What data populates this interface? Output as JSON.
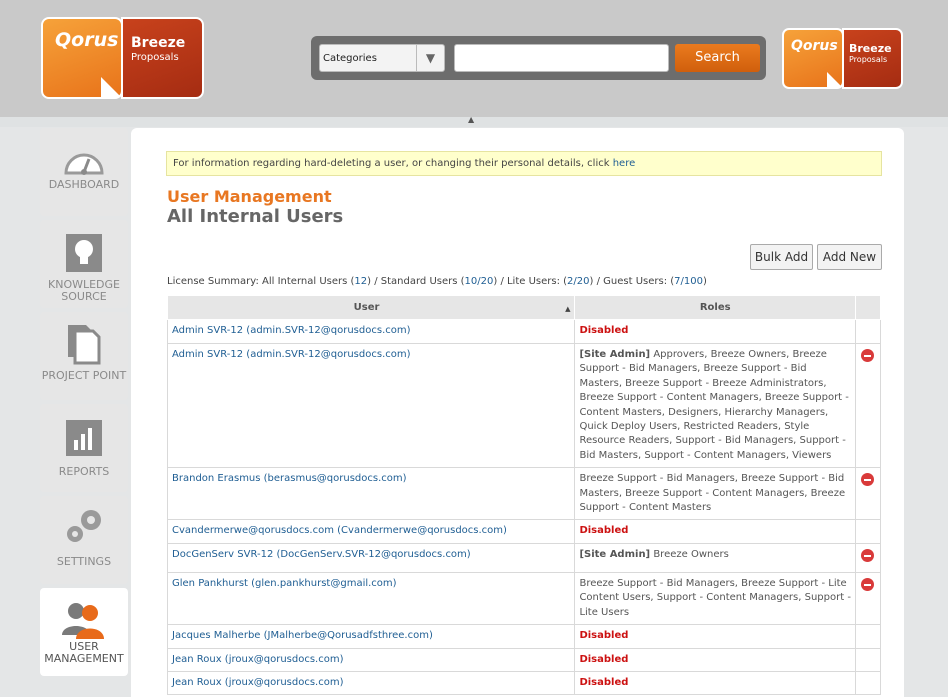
{
  "header": {
    "logo": {
      "brand": "Qorus",
      "product": "Breeze",
      "sub": "Proposals"
    },
    "search": {
      "category": "Categories",
      "placeholder": "",
      "button": "Search"
    }
  },
  "sidebar": {
    "items": [
      {
        "label": "DASHBOARD",
        "icon": "dashboard-gauge-icon"
      },
      {
        "label": "KNOWLEDGE SOURCE",
        "icon": "lightbulb-icon"
      },
      {
        "label": "PROJECT POINT",
        "icon": "documents-icon"
      },
      {
        "label": "REPORTS",
        "icon": "bar-chart-icon"
      },
      {
        "label": "SETTINGS",
        "icon": "gears-icon"
      },
      {
        "label": "USER MANAGEMENT",
        "icon": "users-icon",
        "active": true
      }
    ]
  },
  "main": {
    "info": {
      "text": "For information regarding hard-deleting a user, or changing their personal details, click ",
      "link": "here"
    },
    "title": "User Management",
    "subtitle": "All Internal Users",
    "buttons": {
      "bulk_add": "Bulk Add",
      "add_new": "Add New"
    },
    "license": {
      "prefix": "License Summary: All Internal Users (",
      "all": "12",
      "standard_label": ") / Standard Users (",
      "standard": "10/20",
      "lite_label": ") / Lite Users: (",
      "lite": "2/20",
      "guest_label": ") / Guest Users: (",
      "guest": "7/100",
      "suffix": ")"
    },
    "table": {
      "headers": {
        "user": "User",
        "roles": "Roles"
      },
      "rows": [
        {
          "user": "Admin SVR-12 (admin.SVR-12@qorusdocs.com)",
          "disabled": "Disabled"
        },
        {
          "user": "Admin SVR-12 (admin.SVR-12@qorusdocs.com)",
          "admin": "[Site Admin]",
          "roles": " Approvers, Breeze Owners, Breeze Support - Bid Managers, Breeze Support - Bid Masters, Breeze Support - Breeze Administrators, Breeze Support - Content Managers, Breeze Support - Content Masters, Designers, Hierarchy Managers, Quick Deploy Users, Restricted Readers, Style Resource Readers, Support - Bid Managers, Support - Bid Masters, Support - Content Managers, Viewers"
        },
        {
          "user": "Brandon Erasmus (berasmus@qorusdocs.com)",
          "roles": "Breeze Support - Bid Managers, Breeze Support - Bid Masters, Breeze Support - Content Managers, Breeze Support - Content Masters"
        },
        {
          "user": "Cvandermerwe@qorusdocs.com (Cvandermerwe@qorusdocs.com)",
          "disabled": "Disabled"
        },
        {
          "user": "DocGenServ SVR-12 (DocGenServ.SVR-12@qorusdocs.com)",
          "admin": "[Site Admin]",
          "roles": " Breeze Owners"
        },
        {
          "user": "Glen Pankhurst (glen.pankhurst@gmail.com)",
          "roles": "Breeze Support - Bid Managers, Breeze Support - Lite Content Users, Support - Content Managers, Support - Lite Users"
        },
        {
          "user": "Jacques Malherbe (JMalherbe@Qorusadfsthree.com)",
          "disabled": "Disabled"
        },
        {
          "user": "Jean Roux (jroux@qorusdocs.com)",
          "disabled": "Disabled"
        },
        {
          "user": "Jean Roux (jroux@qorusdocs.com)",
          "disabled": "Disabled"
        }
      ]
    }
  }
}
